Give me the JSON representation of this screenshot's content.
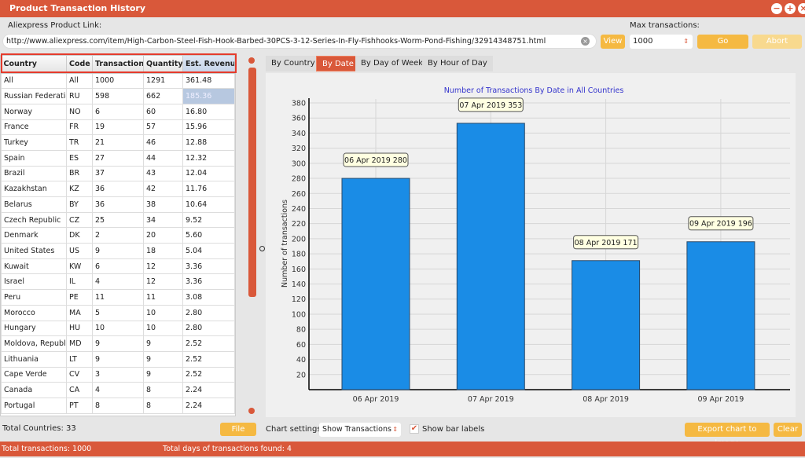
{
  "window": {
    "title": "Product Transaction History"
  },
  "top": {
    "link_label": "Aliexpress Product Link:",
    "url": "http://www.aliexpress.com/item/High-Carbon-Steel-Fish-Hook-Barbed-30PCS-3-12-Series-In-Fly-Fishhooks-Worm-Pond-Fishing/32914348751.html",
    "view": "View",
    "max_label": "Max transactions:",
    "max_value": "1000",
    "go": "Go",
    "abort": "Abort"
  },
  "table": {
    "columns": [
      "Country",
      "Code",
      "Transactions",
      "Quantity",
      "Est. Revenue"
    ],
    "rows": [
      [
        "All",
        "All",
        "1000",
        "1291",
        "361.48"
      ],
      [
        "Russian Federation",
        "RU",
        "598",
        "662",
        "185.36"
      ],
      [
        "Norway",
        "NO",
        "6",
        "60",
        "16.80"
      ],
      [
        "France",
        "FR",
        "19",
        "57",
        "15.96"
      ],
      [
        "Turkey",
        "TR",
        "21",
        "46",
        "12.88"
      ],
      [
        "Spain",
        "ES",
        "27",
        "44",
        "12.32"
      ],
      [
        "Brazil",
        "BR",
        "37",
        "43",
        "12.04"
      ],
      [
        "Kazakhstan",
        "KZ",
        "36",
        "42",
        "11.76"
      ],
      [
        "Belarus",
        "BY",
        "36",
        "38",
        "10.64"
      ],
      [
        "Czech Republic",
        "CZ",
        "25",
        "34",
        "9.52"
      ],
      [
        "Denmark",
        "DK",
        "2",
        "20",
        "5.60"
      ],
      [
        "United States",
        "US",
        "9",
        "18",
        "5.04"
      ],
      [
        "Kuwait",
        "KW",
        "6",
        "12",
        "3.36"
      ],
      [
        "Israel",
        "IL",
        "4",
        "12",
        "3.36"
      ],
      [
        "Peru",
        "PE",
        "11",
        "11",
        "3.08"
      ],
      [
        "Morocco",
        "MA",
        "5",
        "10",
        "2.80"
      ],
      [
        "Hungary",
        "HU",
        "10",
        "10",
        "2.80"
      ],
      [
        "Moldova, Republic",
        "MD",
        "9",
        "9",
        "2.52"
      ],
      [
        "Lithuania",
        "LT",
        "9",
        "9",
        "2.52"
      ],
      [
        "Cape Verde",
        "CV",
        "3",
        "9",
        "2.52"
      ],
      [
        "Canada",
        "CA",
        "4",
        "8",
        "2.24"
      ],
      [
        "Portugal",
        "PT",
        "8",
        "8",
        "2.24"
      ]
    ]
  },
  "tabs": [
    "By Country",
    "By Date",
    "By Day of Week",
    "By Hour of Day"
  ],
  "active_tab": "By Date",
  "chart_data": {
    "type": "bar",
    "title": "Number of Transactions By Date in All Countries",
    "ylabel": "Number of transactions",
    "xlabel": "",
    "categories": [
      "06 Apr 2019",
      "07 Apr 2019",
      "08 Apr 2019",
      "09 Apr 2019"
    ],
    "values": [
      280,
      353,
      171,
      196
    ],
    "bar_labels": [
      "06 Apr 2019 280",
      "07 Apr 2019 353",
      "08 Apr 2019 171",
      "09 Apr 2019 196"
    ],
    "ylim": [
      0,
      380
    ],
    "yticks": [
      20,
      40,
      60,
      80,
      100,
      120,
      140,
      160,
      180,
      200,
      220,
      240,
      260,
      280,
      300,
      320,
      340,
      360,
      380
    ],
    "grid": true,
    "bar_color": "#1a8ce6",
    "title_color": "#3333cc"
  },
  "bottom": {
    "total_countries": "Total Countries: 33",
    "file": "File",
    "chart_settings_label": "Chart settings:",
    "chart_setting": "Show Transactions",
    "show_bar_labels": "Show bar labels",
    "export": "Export chart to image",
    "clear": "Clear"
  },
  "status": {
    "total_transactions": "Total transactions: 1000",
    "total_days": "Total days of transactions found: 4"
  },
  "colors": {
    "accent": "#d9583a",
    "button": "#f5b942",
    "highlight_box": "#e53b2c"
  }
}
